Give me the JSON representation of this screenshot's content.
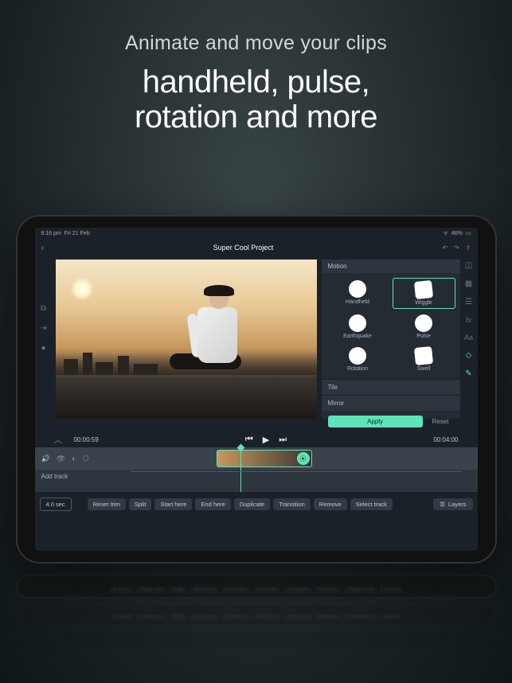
{
  "hero": {
    "subtitle": "Animate and move your clips",
    "title_line1": "handheld, pulse,",
    "title_line2": "rotation and more"
  },
  "statusbar": {
    "time": "6:16 pm",
    "date": "Fri 21 Feb",
    "battery": "46%"
  },
  "header": {
    "title": "Super Cool Project"
  },
  "panel": {
    "title": "Motion",
    "tile": "Tile",
    "mirror": "Mirror",
    "apply": "Apply",
    "reset": "Reset"
  },
  "motions": [
    {
      "label": "Handheld",
      "shape": "circle"
    },
    {
      "label": "Wiggle",
      "shape": "square",
      "selected": true
    },
    {
      "label": "Earthquake",
      "shape": "circle"
    },
    {
      "label": "Pulse",
      "shape": "circle"
    },
    {
      "label": "Rotation",
      "shape": "circle"
    },
    {
      "label": "Swell",
      "shape": "square"
    }
  ],
  "transport": {
    "current": "00:00:59",
    "total": "00:04:00"
  },
  "timeline": {
    "add_track": "Add track"
  },
  "toolbar": {
    "duration": "4.0 sec",
    "reset_trim": "Reset trim",
    "split": "Split",
    "start_here": "Start here",
    "end_here": "End here",
    "duplicate": "Duplicate",
    "transition": "Transition",
    "remove": "Remove",
    "select_track": "Select track",
    "layers": "Layers"
  },
  "colors": {
    "accent": "#5de4b8"
  }
}
